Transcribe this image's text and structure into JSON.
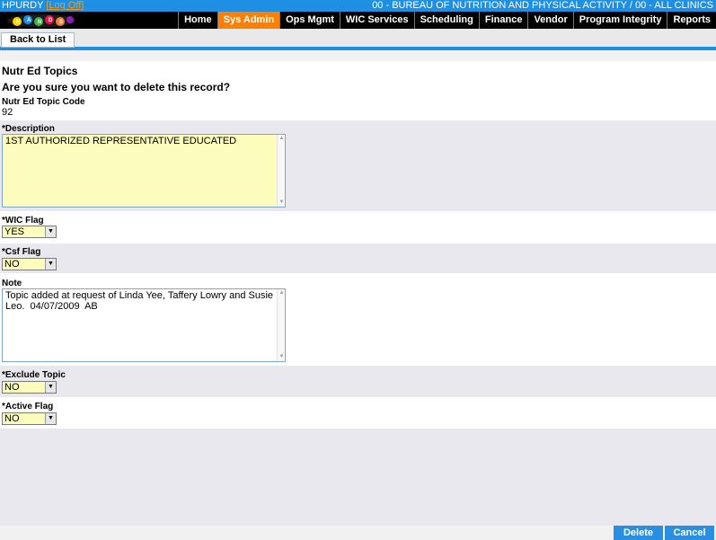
{
  "header": {
    "user": "HPURDY",
    "logoff_label": "Log Off",
    "agency": "00 - BUREAU OF NUTRITION AND PHYSICAL ACTIVITY / 00 - ALL CLINICS"
  },
  "nav": {
    "items": [
      "Home",
      "Sys Admin",
      "Ops Mgmt",
      "WIC Services",
      "Scheduling",
      "Finance",
      "Vendor",
      "Program Integrity",
      "Reports"
    ],
    "active": "Sys Admin"
  },
  "toolbar": {
    "back_label": "Back to List"
  },
  "page": {
    "title": "Nutr Ed Topics",
    "confirm": "Are you sure you want to delete this record?"
  },
  "fields": {
    "code_label": "Nutr Ed Topic Code",
    "code_value": "92",
    "description_label": "*Description",
    "description_value": "1ST AUTHORIZED REPRESENTATIVE EDUCATED",
    "wic_flag_label": "*WIC Flag",
    "wic_flag_value": "YES",
    "csf_flag_label": "*Csf Flag",
    "csf_flag_value": "NO",
    "note_label": "Note",
    "note_line1": "Topic added at request of Linda Yee, Taffery Lowry and Susie",
    "note_line2": "Leo.  04/07/2009  AB",
    "exclude_label": "*Exclude Topic",
    "exclude_value": "NO",
    "active_label": "*Active Flag",
    "active_value": "NO"
  },
  "actions": {
    "delete_label": "Delete",
    "cancel_label": "Cancel"
  },
  "colors": {
    "header_blue": "#1e8fe3",
    "active_tab": "#ff7f00",
    "input_yellow": "#fcfcbc",
    "button_blue": "#2a8fe0"
  }
}
